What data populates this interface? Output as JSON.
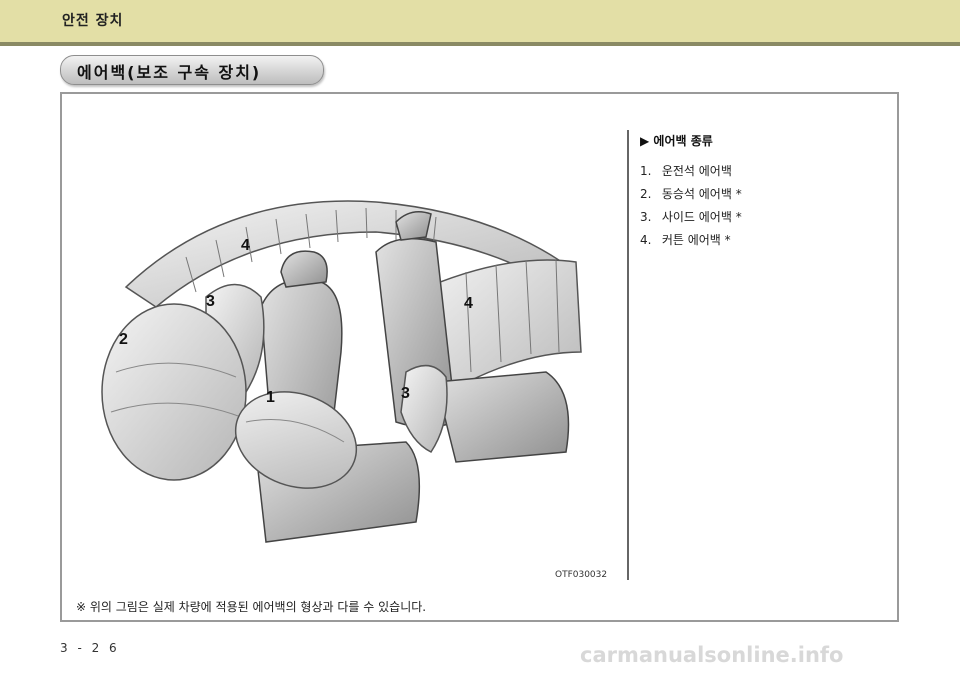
{
  "header": {
    "title": "안전 장치"
  },
  "section": {
    "title": "에어백(보조 구속 장치)"
  },
  "figure": {
    "code": "OTF030032",
    "callouts": [
      "1",
      "2",
      "3",
      "3",
      "4",
      "4"
    ]
  },
  "legend": {
    "title": "▶ 에어백 종류",
    "items": [
      {
        "num": "1.",
        "label": "운전석 에어백"
      },
      {
        "num": "2.",
        "label": "동승석 에어백 *"
      },
      {
        "num": "3.",
        "label": "사이드 에어백 *"
      },
      {
        "num": "4.",
        "label": "커튼 에어백 *"
      }
    ]
  },
  "footnote": "※ 위의 그림은 실제 차량에 적용된 에어백의 형상과 다를 수 있습니다.",
  "page": {
    "number": "3 - 2 6"
  },
  "watermark": "carmanualsonline.info",
  "colors": {
    "header_band": "#e3dfa6",
    "header_line": "#8a8a64",
    "frame_border": "#9a9a9a"
  }
}
